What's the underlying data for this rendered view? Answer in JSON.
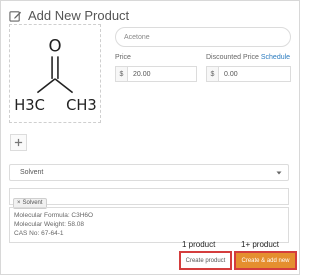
{
  "header": {
    "title": "Add New Product",
    "icon": "pencil-square-icon"
  },
  "product_image": {
    "structure": {
      "top_atom": "O",
      "left_group": "H3C",
      "right_group": "CH3"
    }
  },
  "name_field": {
    "value": "Acetone"
  },
  "price": {
    "label": "Price",
    "currency_symbol": "$",
    "value": "20.00"
  },
  "discount": {
    "label": "Discounted Price",
    "schedule_link": "Schedule",
    "currency_symbol": "$",
    "value": "0.00"
  },
  "add_image_button": {
    "icon": "plus-icon"
  },
  "category_select": {
    "value": "Solvent"
  },
  "tags": [
    {
      "label": "Solvent",
      "remove": "×"
    }
  ],
  "description": {
    "lines": [
      "Molecular Formula: C3H6O",
      "Molecular Weight: 58.08",
      "CAS No: 67-64-1"
    ]
  },
  "annotations": {
    "single": "1 product",
    "multi": "1+ product"
  },
  "buttons": {
    "create": "Create product",
    "create_add_new": "Create & add new"
  },
  "colors": {
    "accent": "#e58f2f",
    "highlight_border": "#d43d3d",
    "link": "#2a7bbf"
  }
}
